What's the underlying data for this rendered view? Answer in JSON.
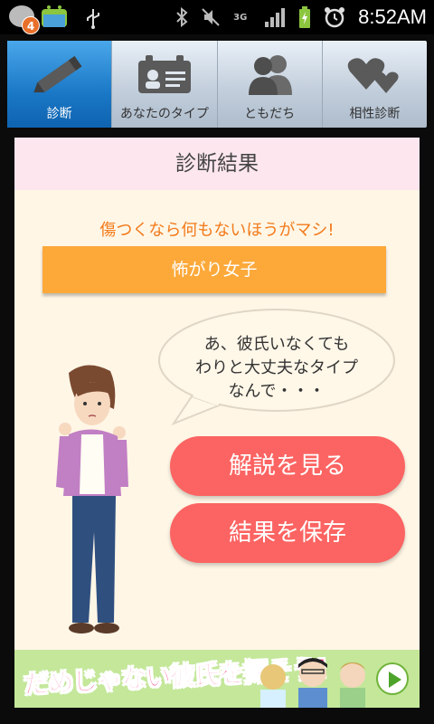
{
  "status_bar": {
    "notification_count": "4",
    "network": "3G",
    "time": "8:52AM"
  },
  "tabs": [
    {
      "label": "診断",
      "icon": "pencil-icon",
      "active": true
    },
    {
      "label": "あなたのタイプ",
      "icon": "id-card-icon",
      "active": false
    },
    {
      "label": "ともだち",
      "icon": "friends-icon",
      "active": false
    },
    {
      "label": "相性診断",
      "icon": "hearts-icon",
      "active": false
    }
  ],
  "result": {
    "title": "診断結果",
    "catchphrase": "傷つくなら何もないほうがマシ!",
    "type_name": "怖がり女子",
    "speech_lines": [
      "あ、彼氏いなくても",
      "わりと大丈夫なタイプ",
      "なんで・・・"
    ]
  },
  "buttons": {
    "explanation": "解説を見る",
    "save": "結果を保存"
  },
  "ad": {
    "text": "だめじゃない彼氏を探そう!"
  },
  "colors": {
    "tab_active": "#1a78c6",
    "header_pink": "#fde6ee",
    "panel_bg": "#fff6e6",
    "accent_orange": "#fca93a",
    "catch_orange": "#f27a1a",
    "button_red": "#fb6462",
    "ad_green": "#c4e79a"
  }
}
